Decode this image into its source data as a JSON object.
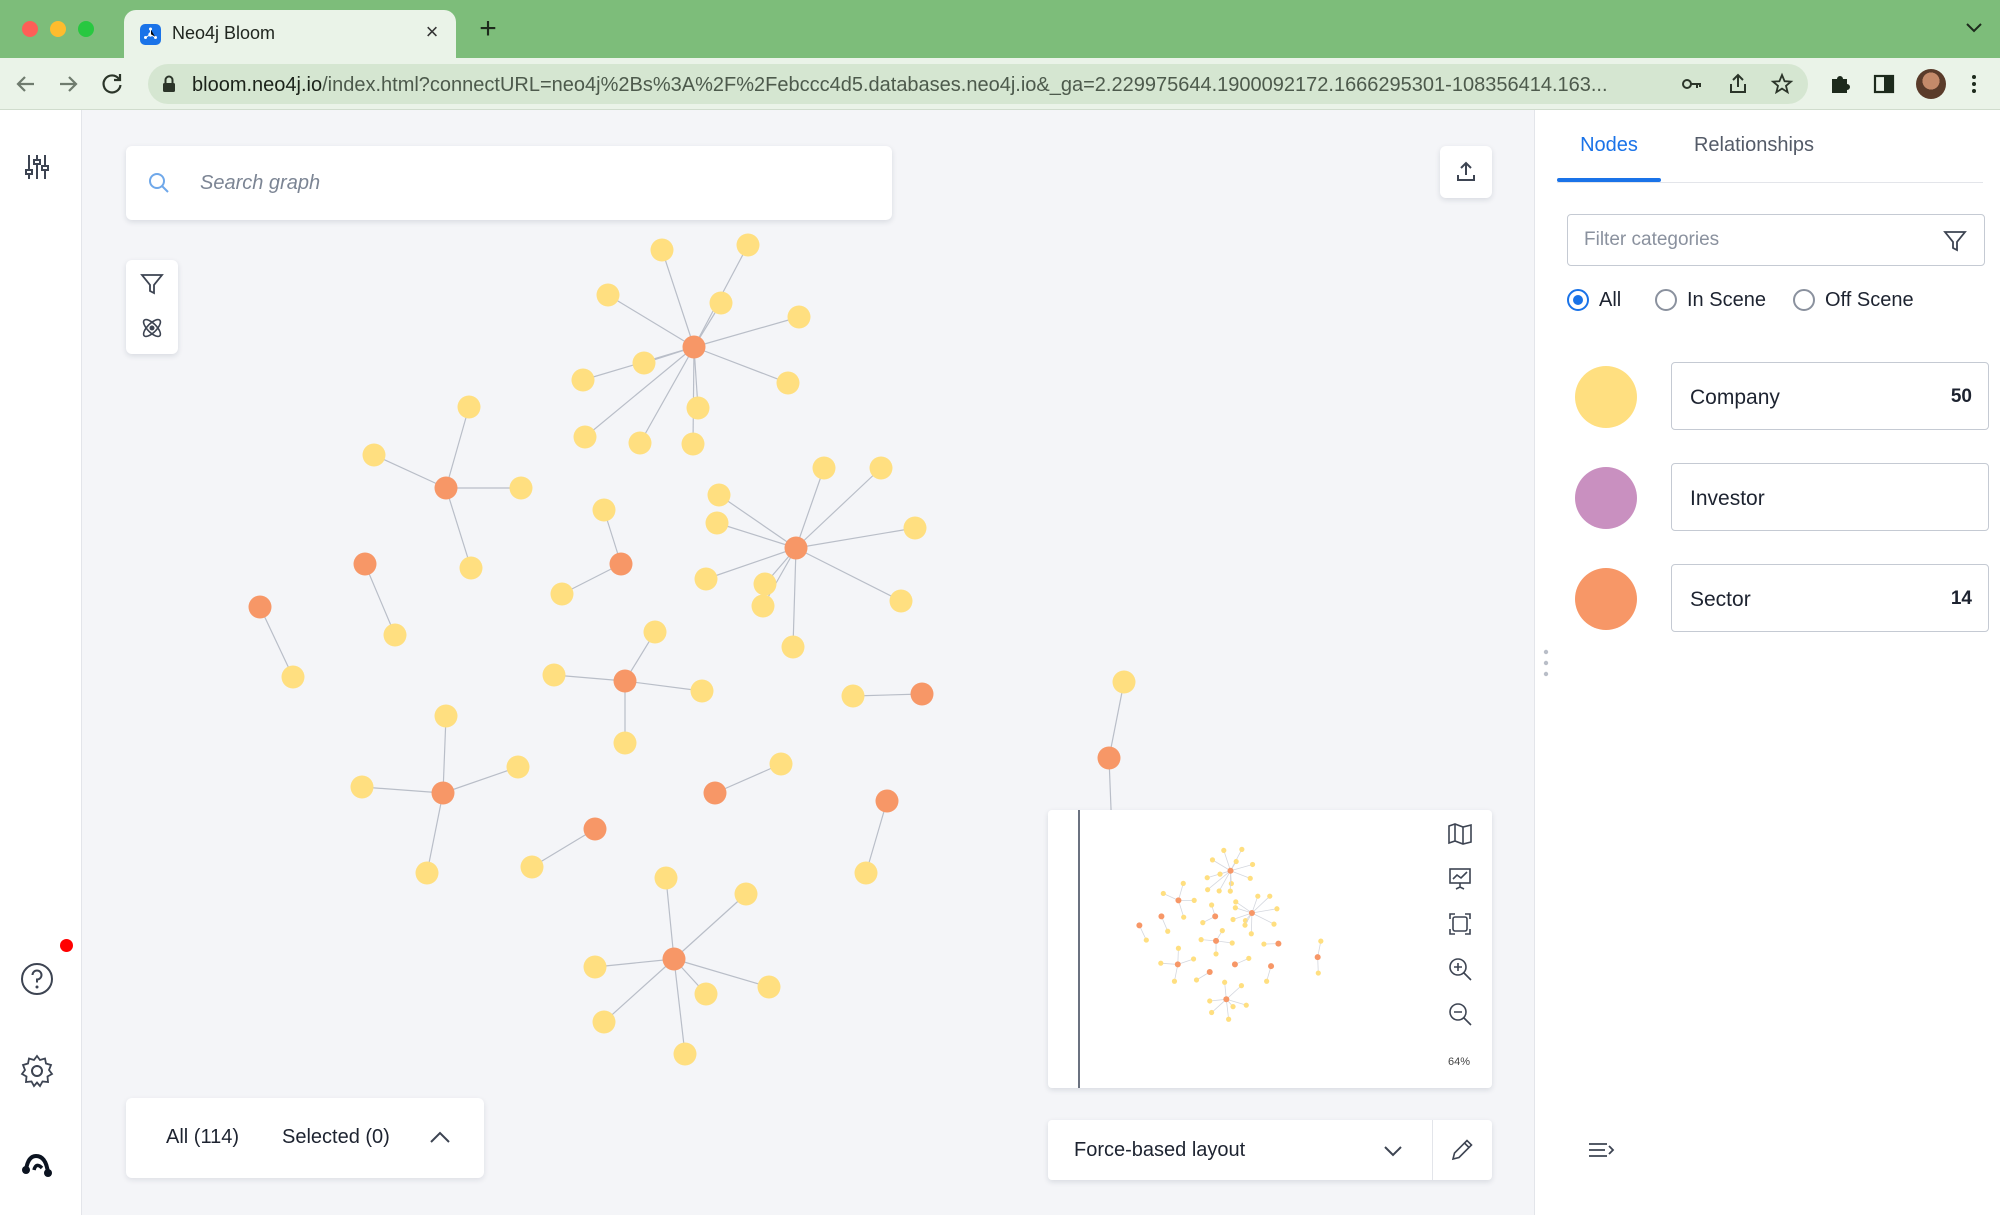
{
  "browser": {
    "tab_title": "Neo4j Bloom",
    "close_glyph": "×",
    "new_tab_glyph": "+",
    "url_host": "bloom.neo4j.io",
    "url_rest": "/index.html?connectURL=neo4j%2Bs%3A%2F%2Febccc4d5.databases.neo4j.io&_ga=2.229975644.1900092172.1666295301-108356414.163..."
  },
  "search": {
    "placeholder": "Search graph"
  },
  "counter": {
    "all_label": "All (114)",
    "selected_label": "Selected (0)"
  },
  "minimap": {
    "zoom_label": "64%"
  },
  "layout": {
    "selected": "Force-based layout"
  },
  "panel": {
    "tabs": {
      "nodes": "Nodes",
      "relationships": "Relationships"
    },
    "filter_placeholder": "Filter categories",
    "radios": [
      {
        "label": "All",
        "selected": true
      },
      {
        "label": "In Scene",
        "selected": false
      },
      {
        "label": "Off Scene",
        "selected": false
      }
    ],
    "categories": [
      {
        "name": "Company",
        "count": "50",
        "color": "#ffdf80"
      },
      {
        "name": "Investor",
        "count": "",
        "color": "#c990c0"
      },
      {
        "name": "Sector",
        "count": "14",
        "color": "#f79767"
      }
    ]
  },
  "colors": {
    "accent": "#1a73e8",
    "company": "#ffdf80",
    "sector": "#f79767",
    "investor": "#c990c0",
    "edge": "#b9bec8"
  },
  "icons": {
    "sidebar": [
      "sliders-icon",
      "help-icon",
      "settings-icon",
      "neo4j-logo-icon"
    ],
    "canvas": [
      "search-icon",
      "filter-icon",
      "atom-icon",
      "export-icon",
      "chevron-up-icon"
    ],
    "minimap": [
      "map-icon",
      "presentation-icon",
      "fit-icon",
      "zoom-in-icon",
      "zoom-out-icon"
    ]
  }
}
